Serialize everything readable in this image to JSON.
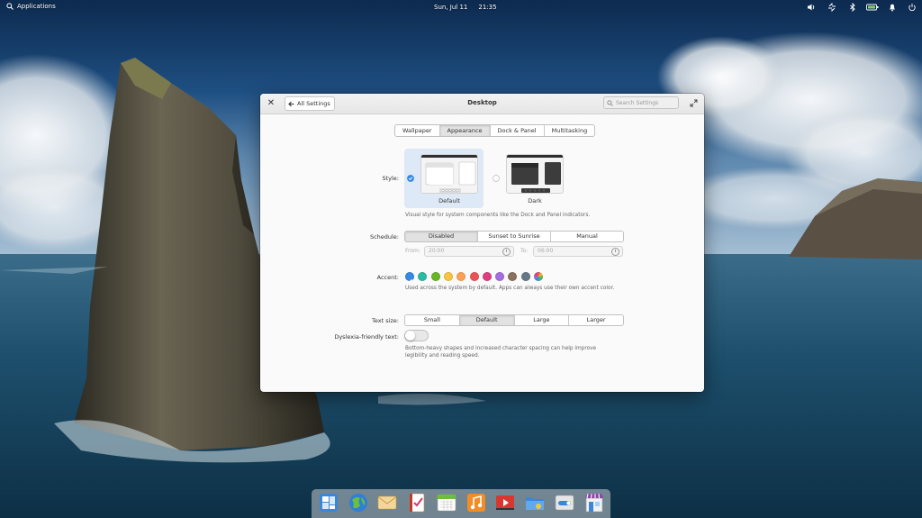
{
  "panel": {
    "applications_label": "Applications",
    "date": "Sun, Jul 11",
    "time": "21:35",
    "indicators": [
      "volume-icon",
      "network-icon",
      "bluetooth-icon",
      "battery-icon",
      "notifications-icon"
    ]
  },
  "window": {
    "title": "Desktop",
    "back_label": "All Settings",
    "search_placeholder": "Search Settings",
    "tabs": [
      {
        "label": "Wallpaper",
        "active": false
      },
      {
        "label": "Appearance",
        "active": true
      },
      {
        "label": "Dock & Panel",
        "active": false
      },
      {
        "label": "Multitasking",
        "active": false
      }
    ]
  },
  "appearance": {
    "style_label": "Style:",
    "styles": [
      {
        "name": "Default",
        "selected": true
      },
      {
        "name": "Dark",
        "selected": false
      }
    ],
    "style_description": "Visual style for system components like the Dock and Panel indicators.",
    "schedule_label": "Schedule:",
    "schedule_options": [
      "Disabled",
      "Sunset to Sunrise",
      "Manual"
    ],
    "schedule_selected": "Disabled",
    "from_label": "From:",
    "from_value": "20:00",
    "to_label": "To:",
    "to_value": "06:00",
    "accent_label": "Accent:",
    "accent_colors": [
      {
        "name": "blueberry",
        "color": "#3689e6",
        "selected": true
      },
      {
        "name": "mint",
        "color": "#28bca3"
      },
      {
        "name": "lime",
        "color": "#68b723"
      },
      {
        "name": "banana",
        "color": "#f9c440"
      },
      {
        "name": "orange",
        "color": "#ffa154"
      },
      {
        "name": "strawberry",
        "color": "#ed5353"
      },
      {
        "name": "bubblegum",
        "color": "#de3e80"
      },
      {
        "name": "grape",
        "color": "#a56de2"
      },
      {
        "name": "cocoa",
        "color": "#8a715e"
      },
      {
        "name": "slate",
        "color": "#667885"
      },
      {
        "name": "auto",
        "color": "multicolor"
      }
    ],
    "accent_description": "Used across the system by default. Apps can always use their own accent color.",
    "text_size_label": "Text size:",
    "text_size_options": [
      "Small",
      "Default",
      "Large",
      "Larger"
    ],
    "text_size_selected": "Default",
    "dyslexia_label": "Dyslexia-friendly text:",
    "dyslexia_enabled": false,
    "dyslexia_description_1": "Bottom-heavy shapes and increased character spacing can help improve",
    "dyslexia_description_2": "legibility and reading speed."
  },
  "dock": {
    "apps": [
      "multitasking-view-icon",
      "web-browser-icon",
      "mail-icon",
      "tasks-icon",
      "calendar-icon",
      "music-icon",
      "videos-icon",
      "files-icon",
      "system-settings-icon",
      "appcenter-icon"
    ]
  }
}
